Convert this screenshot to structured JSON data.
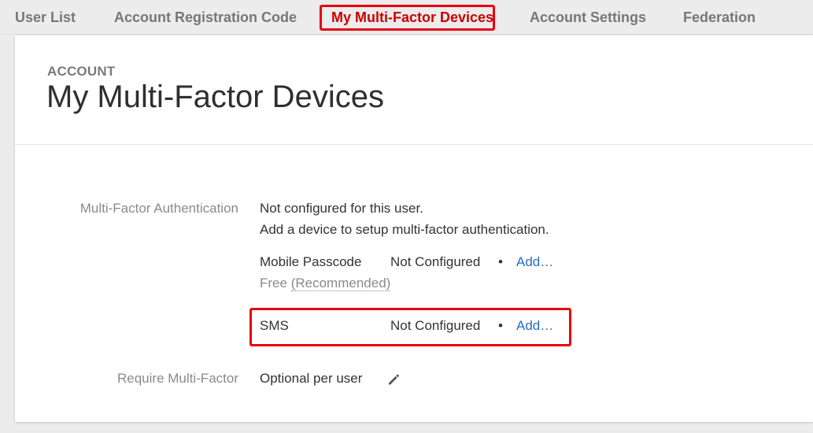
{
  "tabs": [
    {
      "label": "User List"
    },
    {
      "label": "Account Registration Code"
    },
    {
      "label": "My Multi-Factor Devices"
    },
    {
      "label": "Account Settings"
    },
    {
      "label": "Federation"
    }
  ],
  "header": {
    "eyebrow": "ACCOUNT",
    "title": "My Multi-Factor Devices"
  },
  "mfa": {
    "label": "Multi-Factor Authentication",
    "status_line1": "Not configured for this user.",
    "status_line2": "Add a device to setup multi-factor authentication.",
    "devices": [
      {
        "name": "Mobile Passcode",
        "status": "Not Configured",
        "separator": "•",
        "action": "Add…",
        "note_prefix": "Free",
        "note_link": "(Recommended)"
      },
      {
        "name": "SMS",
        "status": "Not Configured",
        "separator": "•",
        "action": "Add…"
      }
    ]
  },
  "require": {
    "label": "Require Multi-Factor",
    "value": "Optional per user",
    "edit_icon": "pencil-icon"
  },
  "colors": {
    "highlight": "#e8000d",
    "link": "#2a6ebb",
    "active_tab": "#cc0000"
  }
}
